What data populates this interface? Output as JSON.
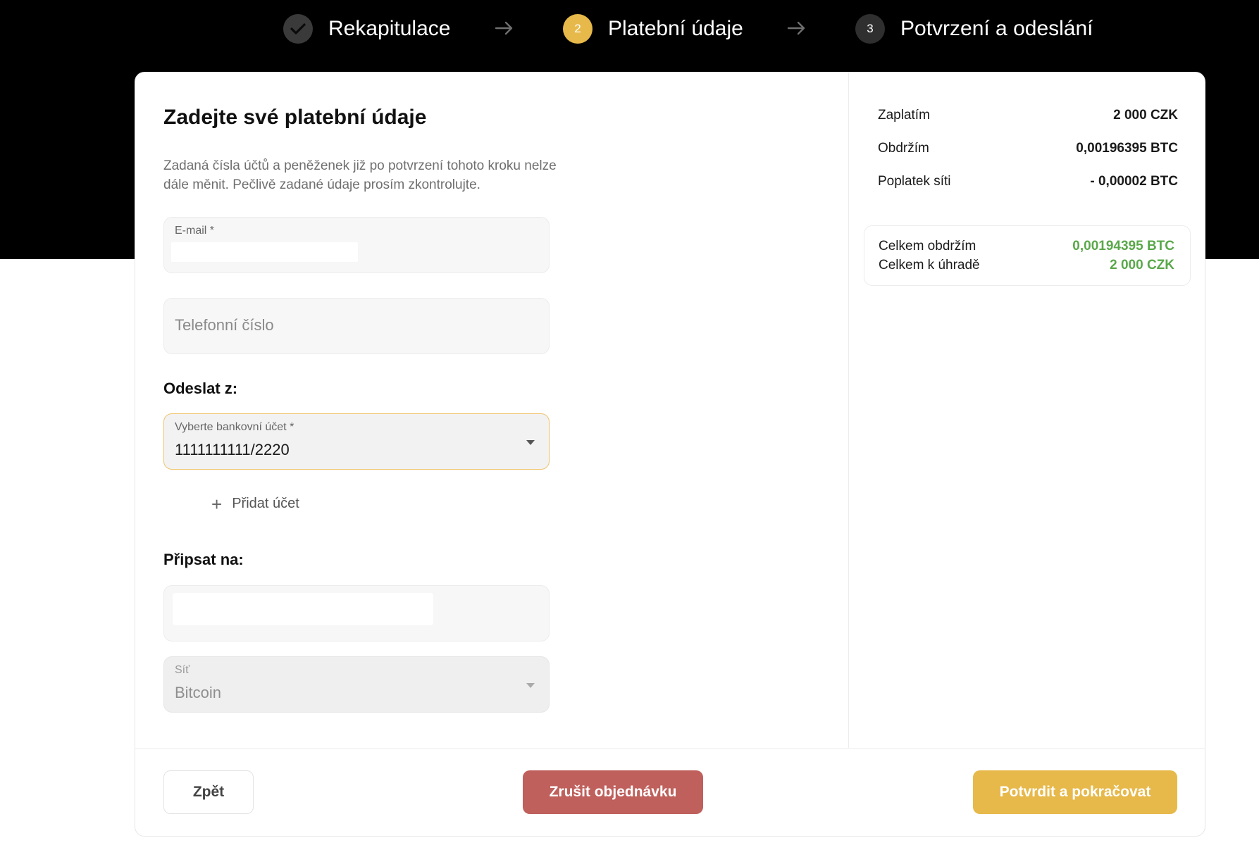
{
  "stepper": {
    "steps": [
      {
        "number": "",
        "label": "Rekapitulace",
        "state": "done",
        "icon": "check-icon"
      },
      {
        "number": "2",
        "label": "Platební údaje",
        "state": "active"
      },
      {
        "number": "3",
        "label": "Potvrzení a odeslání",
        "state": "pending"
      }
    ],
    "arrow_icon": "arrow-right-icon"
  },
  "form": {
    "title": "Zadejte své platební údaje",
    "description": "Zadaná čísla účtů a peněženek již po potvrzení tohoto kroku nelze dále měnit. Pečlivě zadané údaje prosím zkontrolujte.",
    "email": {
      "label": "E-mail *",
      "value": ""
    },
    "phone": {
      "placeholder": "Telefonní číslo",
      "value": ""
    },
    "send_from_label": "Odeslat z:",
    "bank_account": {
      "label": "Vyberte bankovní účet *",
      "value": "1111111111/2220"
    },
    "add_account_label": "Přidat účet",
    "credit_to_label": "Připsat na:",
    "wallet": {
      "value": ""
    },
    "network": {
      "label": "Síť",
      "value": "Bitcoin"
    }
  },
  "summary": {
    "rows": [
      {
        "label": "Zaplatím",
        "value": "2 000 CZK"
      },
      {
        "label": "Obdržím",
        "value": "0,00196395 BTC"
      },
      {
        "label": "Poplatek síti",
        "value": "- 0,00002 BTC"
      }
    ],
    "totals": [
      {
        "label": "Celkem obdržím",
        "value": "0,00194395 BTC"
      },
      {
        "label": "Celkem k úhradě",
        "value": "2 000 CZK"
      }
    ]
  },
  "buttons": {
    "back": "Zpět",
    "cancel": "Zrušit objednávku",
    "confirm": "Potvrdit a pokračovat"
  },
  "colors": {
    "accent": "#e7b94a",
    "danger": "#bf605c",
    "success": "#5aa84a",
    "header_bg": "#000000"
  }
}
